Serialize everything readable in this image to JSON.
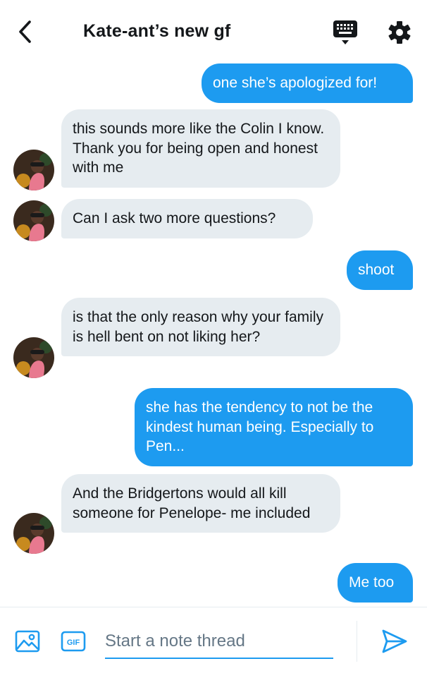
{
  "header": {
    "title": "Kate-ant’s new gf"
  },
  "colors": {
    "accent": "#1d9bf0",
    "incoming_bubble": "#e6ecf0"
  },
  "messages": [
    {
      "from": "me",
      "text": "one she’s apologized for!"
    },
    {
      "from": "them",
      "text": "this sounds more like the Colin I know. Thank you for being open and honest with me"
    },
    {
      "from": "them",
      "text": "Can I ask two more questions?"
    },
    {
      "from": "me",
      "text": "shoot"
    },
    {
      "from": "them",
      "text": "is that the only reason why your family is hell bent on not liking her?"
    },
    {
      "from": "me",
      "text": "she has the tendency to not be the kindest human being. Especially to Pen..."
    },
    {
      "from": "them",
      "text": "And the Bridgertons would all kill someone for Penelope- me included"
    },
    {
      "from": "me",
      "text": "Me too"
    }
  ],
  "composer": {
    "placeholder": "Start a note thread",
    "gif_label": "GIF"
  },
  "icons": {
    "back": "chevron-left-icon",
    "keyboard": "keyboard-icon",
    "settings": "gear-icon",
    "media": "image-icon",
    "gif": "gif-icon",
    "send": "send-icon"
  }
}
